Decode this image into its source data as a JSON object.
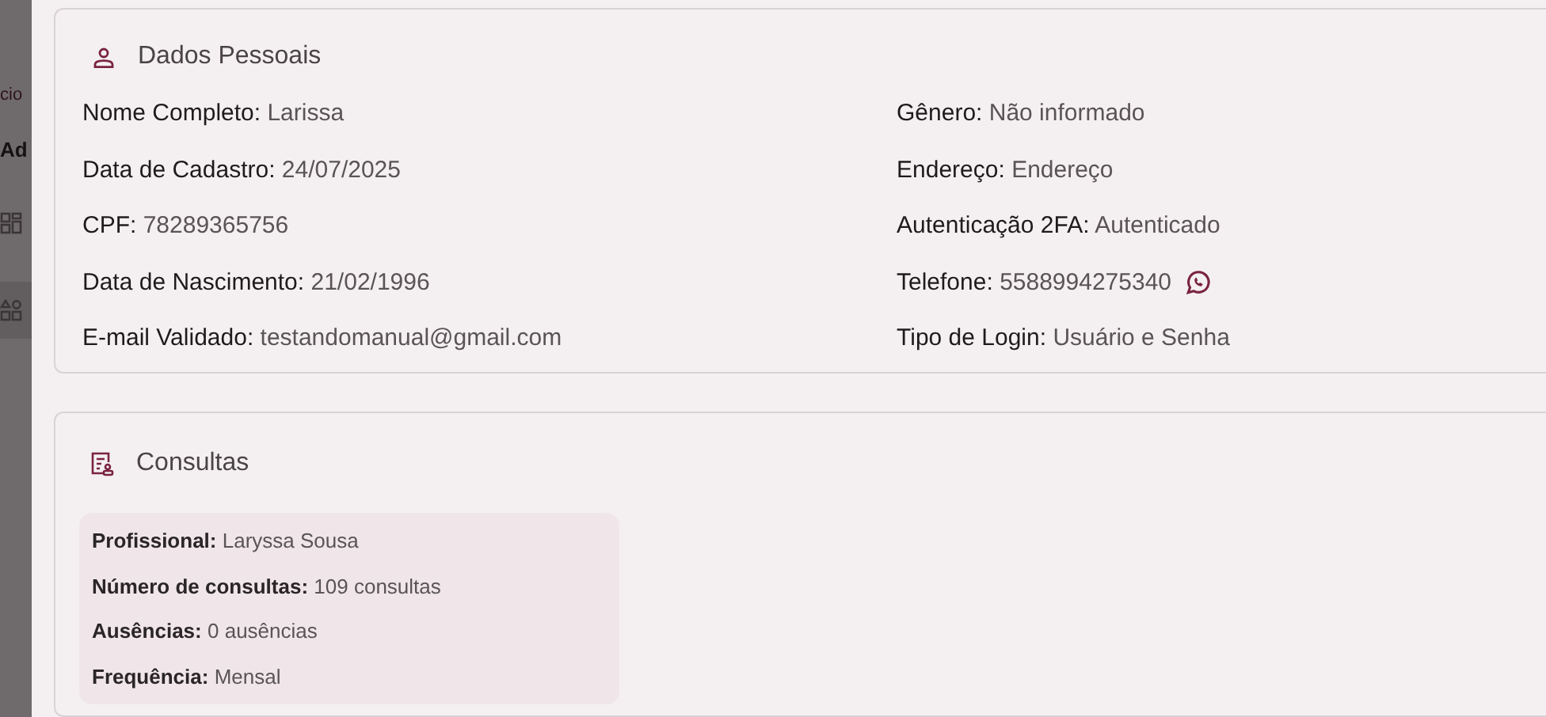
{
  "background": {
    "breadcrumb": "cio",
    "title": "Ad"
  },
  "personal": {
    "title": "Dados Pessoais",
    "left": [
      {
        "label": "Nome Completo:",
        "value": "Larissa"
      },
      {
        "label": "Data de Cadastro:",
        "value": "24/07/2025"
      },
      {
        "label": "CPF:",
        "value": "78289365756"
      },
      {
        "label": "Data de Nascimento:",
        "value": "21/02/1996"
      },
      {
        "label": "E-mail Validado:",
        "value": "testandomanual@gmail.com"
      }
    ],
    "right": [
      {
        "label": "Gênero:",
        "value": "Não informado",
        "kind": "text"
      },
      {
        "label": "Endereço:",
        "value": "Endereço",
        "kind": "text"
      },
      {
        "label": "Autenticação 2FA:",
        "value": "Autenticado",
        "kind": "text"
      },
      {
        "label": "Telefone:",
        "value": "5588994275340",
        "kind": "phone"
      },
      {
        "label": "Tipo de Login:",
        "value": "Usuário e Senha",
        "kind": "text"
      }
    ]
  },
  "consultations": {
    "title": "Consultas",
    "items": [
      {
        "label": "Profissional:",
        "value": "Laryssa Sousa"
      },
      {
        "label": "Número de consultas:",
        "value": "109 consultas"
      },
      {
        "label": "Ausências:",
        "value": "0 ausências"
      },
      {
        "label": "Frequência:",
        "value": "Mensal"
      }
    ]
  }
}
